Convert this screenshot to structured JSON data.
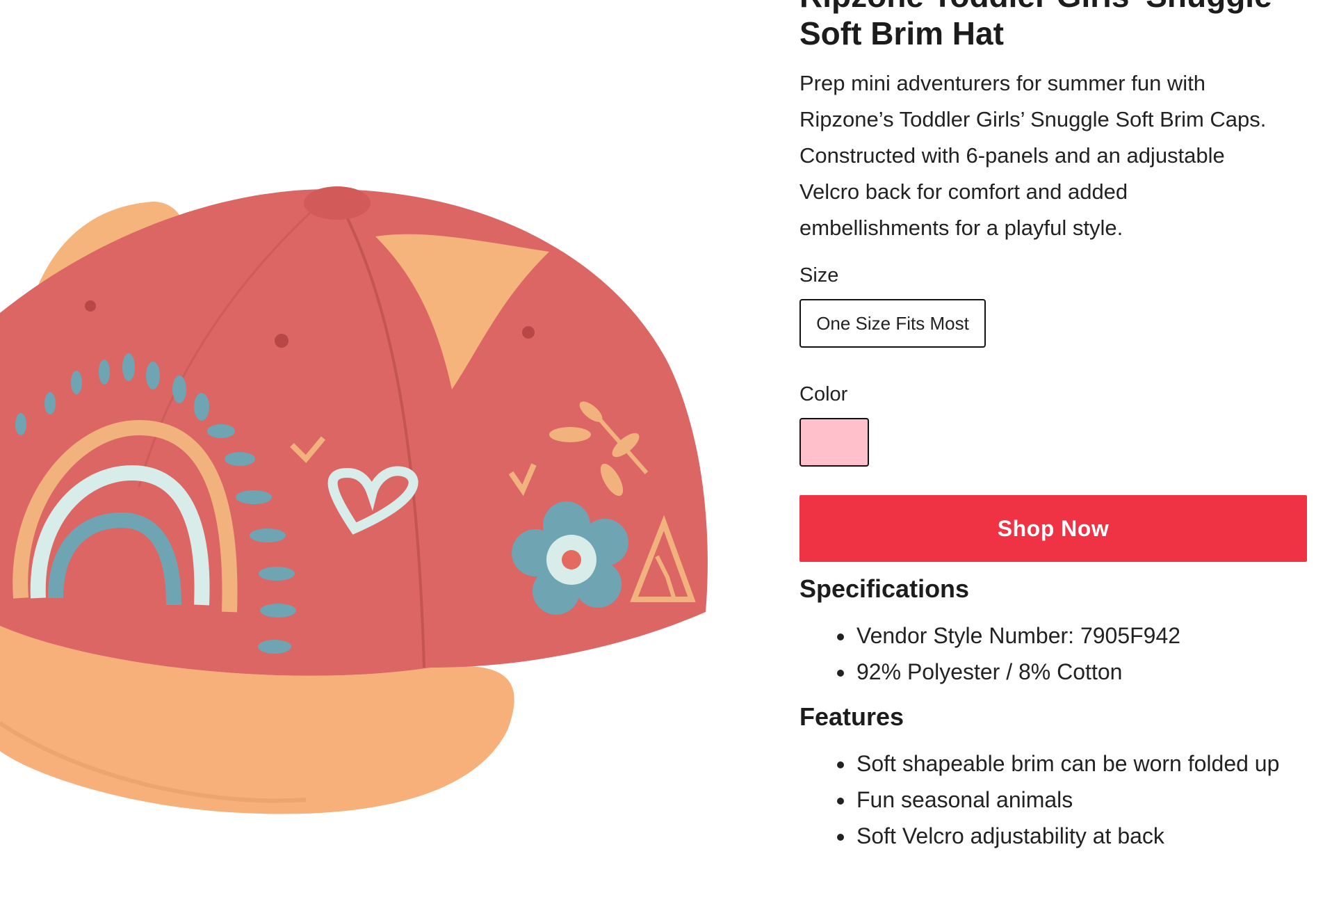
{
  "product": {
    "title_line1": "Ripzone Toddler Girls' Snuggle",
    "title_line2": "Soft Brim Hat",
    "description_lines": [
      "Prep mini adventurers for summer fun with",
      "Ripzone’s Toddler Girls’ Snuggle Soft Brim Caps.",
      "Constructed with 6-panels and an adjustable",
      "Velcro back for comfort and added",
      "embellishments for a playful style."
    ]
  },
  "size": {
    "label": "Size",
    "selected": "One Size Fits Most"
  },
  "color": {
    "label": "Color",
    "swatch_color": "#ffbfcb"
  },
  "cta": {
    "label": "Shop Now",
    "color": "#ef3344"
  },
  "specifications": {
    "heading": "Specifications",
    "items": [
      "Vendor Style Number: 7905F942",
      "92% Polyester / 8% Cotton"
    ]
  },
  "features": {
    "heading": "Features",
    "items": [
      "Soft shapeable brim can be worn folded up",
      "Fun seasonal animals",
      "Soft Velcro adjustability at back"
    ]
  },
  "image": {
    "icon": "toddler-cap-product-image"
  }
}
